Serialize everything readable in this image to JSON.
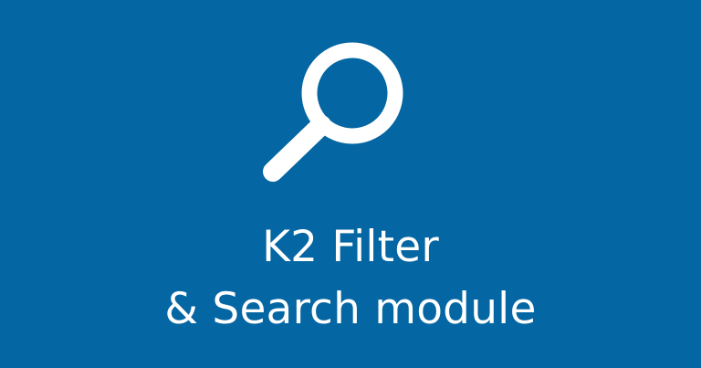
{
  "banner": {
    "background_color": "#0466a3",
    "icon": "search-icon",
    "title_line1": "K2 Filter",
    "title_line2": "& Search module",
    "text_color": "#ffffff"
  }
}
